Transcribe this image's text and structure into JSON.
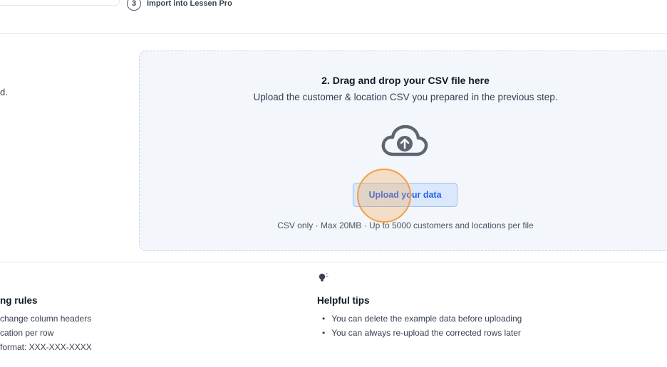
{
  "stepper": {
    "step3_number": "3",
    "step3_label": "Import into Lessen Pro"
  },
  "left_fragment_text": "d.",
  "dropzone": {
    "title": "2. Drag and drop your CSV file here",
    "subtitle": "Upload the customer & location CSV you prepared in the previous step.",
    "upload_button_label": "Upload your data",
    "note": "CSV only · Max 20MB · Up to 5000 customers and locations per file",
    "icon": "cloud-upload-icon"
  },
  "rules": {
    "title": "ng rules",
    "items": [
      "change column headers",
      "cation per row",
      "format: XXX-XXX-XXXX"
    ]
  },
  "tips": {
    "icon": "lightbulb-icon",
    "title": "Helpful tips",
    "items": [
      "You can delete the example data before uploading",
      "You can always re-upload the corrected rows later"
    ]
  },
  "colors": {
    "accent": "#2563eb",
    "dropzone_bg": "#f3f6fb",
    "button_bg": "#dbe8fb",
    "click_indicator": "#f59e42"
  }
}
